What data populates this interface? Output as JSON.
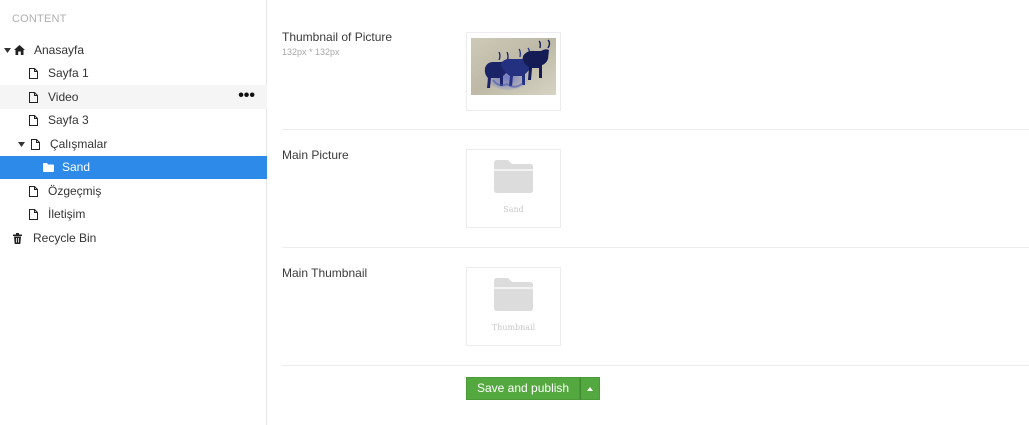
{
  "sidebar": {
    "section_title": "CONTENT",
    "items": [
      {
        "label": "Anasayfa"
      },
      {
        "label": "Sayfa 1"
      },
      {
        "label": "Video",
        "actions": "•••"
      },
      {
        "label": "Sayfa 3"
      },
      {
        "label": "Çalışmalar"
      },
      {
        "label": "Sand"
      },
      {
        "label": "Özgeçmiş"
      },
      {
        "label": "İletişim"
      },
      {
        "label": "Recycle Bin"
      }
    ]
  },
  "fields": [
    {
      "label": "Thumbnail of Picture",
      "hint": "132px * 132px",
      "value_type": "image"
    },
    {
      "label": "Main Picture",
      "caption": "Sand",
      "value_type": "folder"
    },
    {
      "label": "Main Thumbnail",
      "caption": "Thumbnail",
      "value_type": "folder"
    }
  ],
  "actions": {
    "save_publish": "Save and publish"
  },
  "colors": {
    "selected": "#2d8ae8",
    "publish": "#53a93f"
  },
  "icons": {
    "home": "home-icon",
    "page": "document-icon",
    "folder": "folder-icon",
    "trash": "trash-icon",
    "caret": "caret-down-icon"
  }
}
